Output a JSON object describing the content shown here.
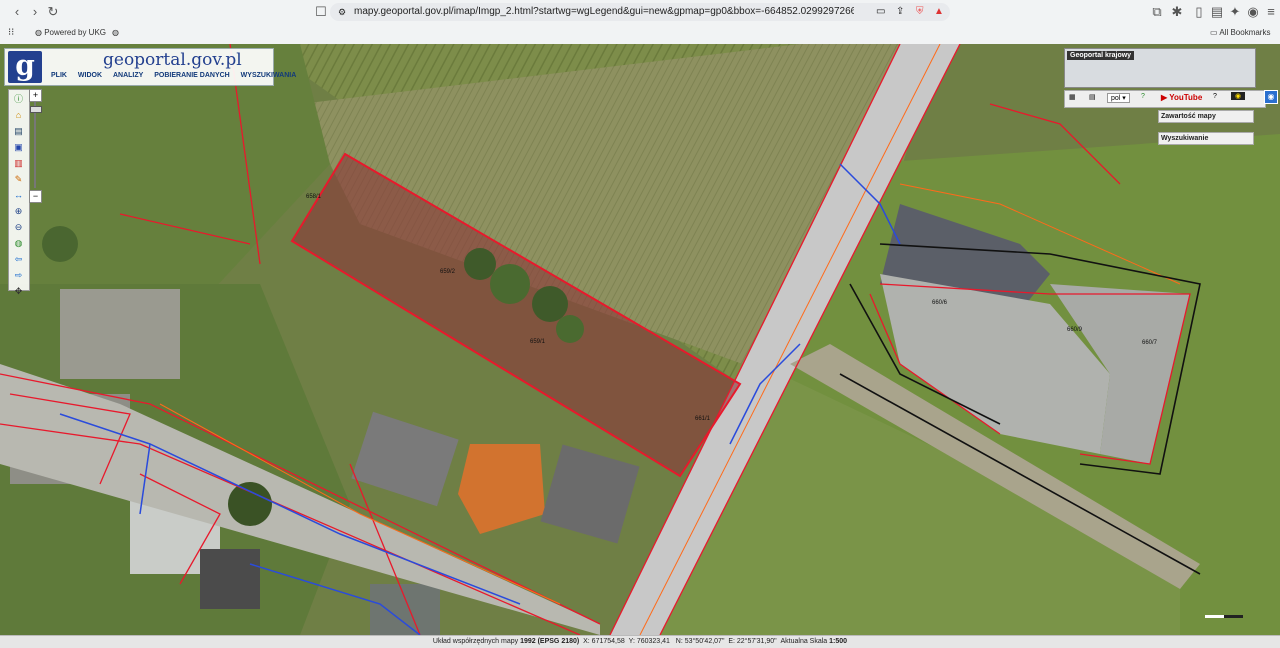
{
  "browser": {
    "url": "mapy.geoportal.gov.pl/imap/Imgp_2.html?startwg=wgLegend&gui=new&gpmap=gp0&bbox=-664852.0299297266%2C-96684.4467...",
    "bookmarks": {
      "powered": "Powered by UKG",
      "all_bookmarks": "All Bookmarks"
    }
  },
  "app": {
    "logo_letter": "g",
    "logo_name": "geoportal.gov.pl",
    "menu": [
      "PLIK",
      "WIDOK",
      "ANALIZY",
      "POBIERANIE DANYCH",
      "WYSZUKIWANIA"
    ]
  },
  "right_panel": {
    "minimap_title": "Geoportal krajowy",
    "language": "pol",
    "youtube": "YouTube",
    "map_contents": "Zawartość mapy",
    "search": "Wyszukiwanie"
  },
  "status": {
    "coord_system_label": "Układ współrzędnych mapy",
    "coord_system": "1992 (EPSG 2180)",
    "x": "X: 671754,58",
    "y": "Y: 760323,41",
    "n": "N: 53°50'42,07\"",
    "e": "E: 22°57'31,90\"",
    "scale_label": "Aktualna Skala",
    "scale": "1:500"
  },
  "parcels": {
    "highlighted": "659/2",
    "p1": "659/1",
    "p2": "660/6",
    "p3": "660/9",
    "p4": "660/7",
    "p5": "658/1",
    "p6": "661/1"
  },
  "colors": {
    "parcel_line": "#e8192c",
    "highlight_fill": "#8a3a3a",
    "road": "#c8c8c8",
    "logo_blue": "#23408f"
  }
}
